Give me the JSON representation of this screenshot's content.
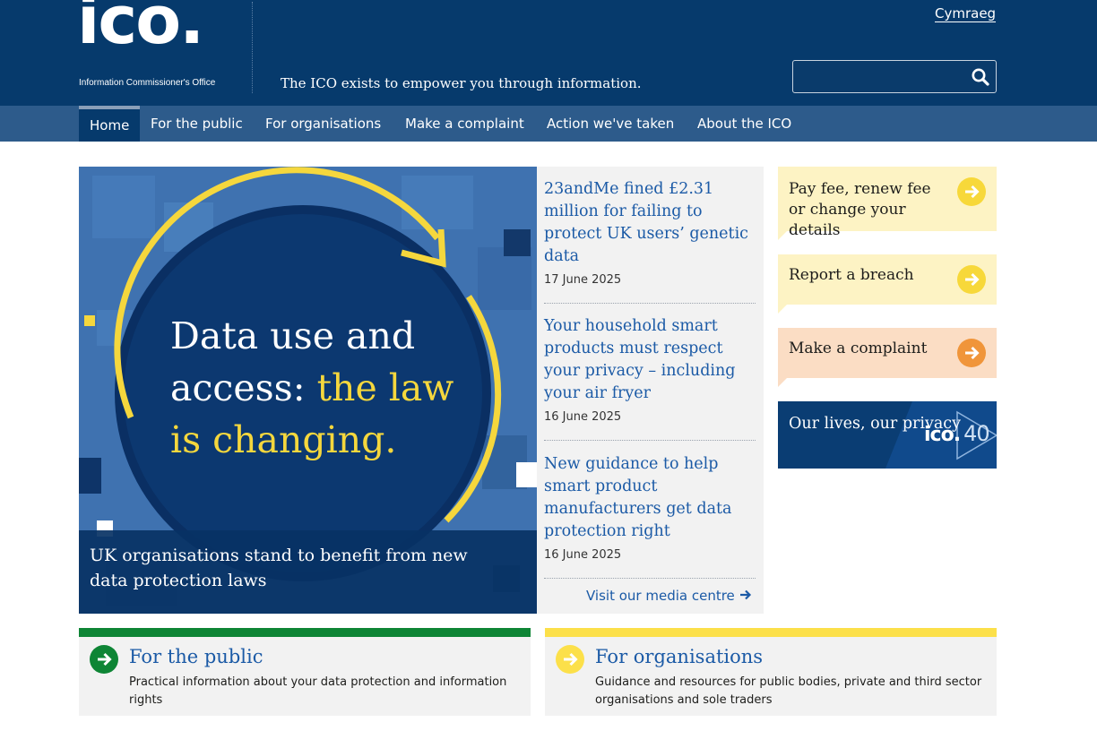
{
  "header": {
    "logo_word": "ico.",
    "logo_subtitle": "Information Commissioner's Office",
    "tagline": "The ICO exists to empower you through information.",
    "language_link": "Cymraeg",
    "search": {
      "placeholder": "",
      "value": ""
    }
  },
  "nav": {
    "items": [
      {
        "label": "Home"
      },
      {
        "label": "For the public"
      },
      {
        "label": "For organisations"
      },
      {
        "label": "Make a complaint"
      },
      {
        "label": "Action we've taken"
      },
      {
        "label": "About the ICO"
      }
    ],
    "active": "Home"
  },
  "hero": {
    "line1": "Data use and",
    "line2a": "access: ",
    "line2b": "the law",
    "line3": "is changing.",
    "caption": "UK organisations stand to benefit from new data protection laws"
  },
  "news": {
    "items": [
      {
        "title": "23andMe fined £2.31 million for failing to protect UK users’ genetic data",
        "date": "17 June 2025"
      },
      {
        "title": "Your household smart products must respect your privacy – including your air fryer",
        "date": "16 June 2025"
      },
      {
        "title": "New guidance to help smart product manufacturers get data protection right",
        "date": "16 June 2025"
      }
    ],
    "more_link": "Visit our media centre"
  },
  "side": {
    "buttons": [
      {
        "label": "Pay fee, renew fee or change your details",
        "bg": "#fdf3c4",
        "circle": "#f7d83a"
      },
      {
        "label": "Report a breach",
        "bg": "#fdf3c4",
        "circle": "#f7d83a"
      },
      {
        "label": "Make a complaint",
        "bg": "#fbddc4",
        "circle": "#f0953a"
      }
    ],
    "promo": {
      "text": "Our lives, our privacy",
      "logo": "ico.",
      "number": "40"
    }
  },
  "cards": [
    {
      "title": "For the public",
      "desc": "Practical information about your data protection and information rights",
      "color": "#0e8535"
    },
    {
      "title": "For organisations",
      "desc": "Guidance and resources for public bodies, private and third sector organisations and sole traders",
      "color": "#fce04a"
    }
  ],
  "colors": {
    "header": "#063a6c",
    "nav": "#2d5b8b",
    "link": "#1b5aa6"
  }
}
